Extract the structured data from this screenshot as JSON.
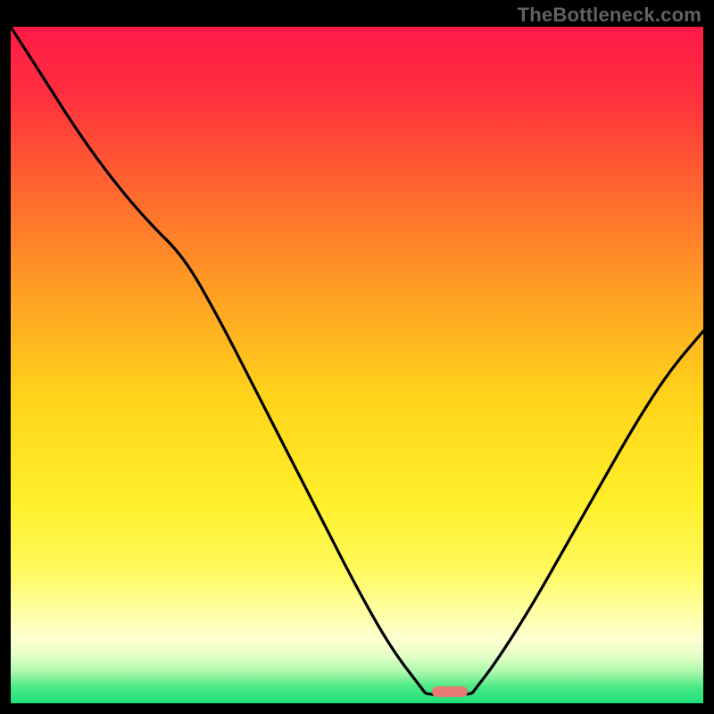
{
  "attribution": "TheBottleneck.com",
  "colors": {
    "gradient_stops": [
      {
        "offset": 0.0,
        "color": "#ff1a49"
      },
      {
        "offset": 0.1,
        "color": "#ff2f3e"
      },
      {
        "offset": 0.25,
        "color": "#ff6a2e"
      },
      {
        "offset": 0.4,
        "color": "#ffa224"
      },
      {
        "offset": 0.55,
        "color": "#ffd41a"
      },
      {
        "offset": 0.7,
        "color": "#ffef2a"
      },
      {
        "offset": 0.8,
        "color": "#fff95a"
      },
      {
        "offset": 0.86,
        "color": "#ffff9e"
      },
      {
        "offset": 0.905,
        "color": "#fdffd1"
      },
      {
        "offset": 0.93,
        "color": "#e5ffc8"
      },
      {
        "offset": 0.955,
        "color": "#a6f7a8"
      },
      {
        "offset": 0.975,
        "color": "#4dea87"
      },
      {
        "offset": 1.0,
        "color": "#1fdf7a"
      }
    ],
    "curve": "#000000",
    "marker": "#e77a74",
    "frame": "#000000"
  },
  "marker": {
    "x_frac_left": 0.608,
    "x_frac_right": 0.66,
    "y_frac": 0.983
  },
  "chart_data": {
    "type": "line",
    "title": "",
    "xlabel": "",
    "ylabel": "",
    "xlim": [
      0,
      1
    ],
    "ylim": [
      0,
      1
    ],
    "series": [
      {
        "name": "bottleneck-curve",
        "x": [
          0.0,
          0.05,
          0.1,
          0.15,
          0.2,
          0.25,
          0.3,
          0.35,
          0.4,
          0.45,
          0.5,
          0.55,
          0.595,
          0.6,
          0.63,
          0.665,
          0.67,
          0.7,
          0.75,
          0.8,
          0.85,
          0.9,
          0.95,
          1.0
        ],
        "y": [
          1.0,
          0.92,
          0.84,
          0.77,
          0.71,
          0.66,
          0.57,
          0.47,
          0.37,
          0.27,
          0.17,
          0.08,
          0.02,
          0.013,
          0.013,
          0.013,
          0.02,
          0.06,
          0.14,
          0.23,
          0.32,
          0.41,
          0.49,
          0.55
        ]
      }
    ],
    "annotations": [
      {
        "type": "marker",
        "x_range": [
          0.608,
          0.66
        ],
        "y": 0.013,
        "label": "optimal-zone"
      }
    ]
  }
}
